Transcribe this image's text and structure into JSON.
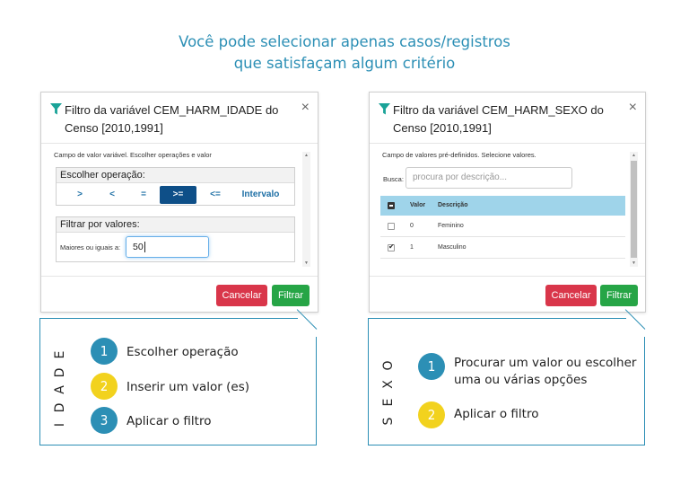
{
  "headline": {
    "line1": "Você pode selecionar apenas casos/registros",
    "line2": "que satisfaçam algum critério"
  },
  "colors": {
    "accent": "#2c8fb5",
    "step_yellow": "#f2d21e",
    "cancel": "#d9364a",
    "filter": "#26a546",
    "active_op": "#0e4f88",
    "table_head": "#9fd4ea"
  },
  "idade_dialog": {
    "title": "Filtro da variável CEM_HARM_IDADE do Censo [2010,1991]",
    "close": "×",
    "hint": "Campo de valor variável. Escolher operações e valor",
    "operation_panel": {
      "header": "Escolher operação:",
      "operations": [
        ">",
        "<",
        "=",
        ">=",
        "<=",
        "Intervalo"
      ],
      "selected": ">="
    },
    "values_panel": {
      "header": "Filtrar por valores:",
      "label": "Maiores ou iguais a:",
      "value": "50"
    },
    "cancel_label": "Cancelar",
    "filter_label": "Filtrar"
  },
  "sexo_dialog": {
    "title": "Filtro da variável CEM_HARM_SEXO do Censo [2010,1991]",
    "close": "×",
    "hint": "Campo de valores pré-definidos. Selecione valores.",
    "search_label": "Busca:",
    "search_placeholder": "procura por descrição...",
    "table": {
      "columns": [
        "Valor",
        "Descrição"
      ],
      "rows": [
        {
          "valor": "0",
          "descricao": "Feminino",
          "checked": false
        },
        {
          "valor": "1",
          "descricao": "Masculino",
          "checked": true
        }
      ]
    },
    "cancel_label": "Cancelar",
    "filter_label": "Filtrar"
  },
  "idade_callout": {
    "side_label": "IDADE",
    "steps": [
      {
        "num": "1",
        "text": "Escolher operação",
        "color": "blue"
      },
      {
        "num": "2",
        "text": "Inserir um valor (es)",
        "color": "yellow"
      },
      {
        "num": "3",
        "text": "Aplicar o filtro",
        "color": "blue"
      }
    ]
  },
  "sexo_callout": {
    "side_label": "SEXO",
    "steps": [
      {
        "num": "1",
        "text_line1": "Procurar um valor ou escolher",
        "text_line2": "uma ou várias opções",
        "color": "blue"
      },
      {
        "num": "2",
        "text": "Aplicar o filtro",
        "color": "yellow"
      }
    ]
  }
}
